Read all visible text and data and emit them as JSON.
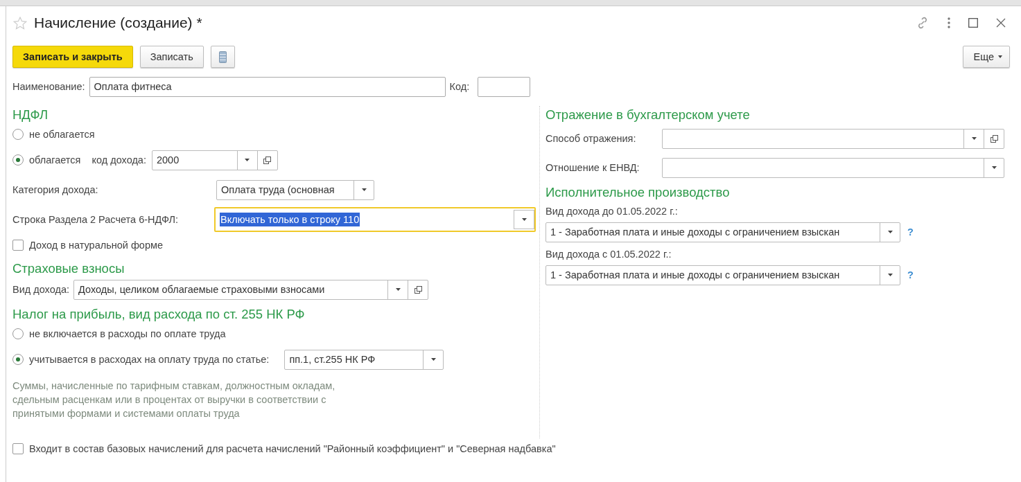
{
  "window": {
    "title": "Начисление (создание) *"
  },
  "toolbar": {
    "primary": "Записать и закрыть",
    "secondary": "Записать",
    "more": "Еще"
  },
  "header_fields": [
    {
      "label": "Наименование:",
      "value": "Оплата фитнеса",
      "kind": "text",
      "focused": false
    },
    {
      "label": "Код:",
      "kind": "text",
      "focused": false
    }
  ],
  "ndfl": {
    "title": "НДФЛ",
    "options": [
      {
        "label": "не облагается",
        "selected": false
      },
      {
        "label": "облагается",
        "selected": true,
        "field": {
          "label": "код дохода:",
          "value": "2000",
          "kind": "select-open",
          "focused": false
        }
      }
    ],
    "fields": [
      {
        "label": "Категория дохода:",
        "value": "Оплата труда (основная",
        "kind": "select",
        "focused": false
      },
      {
        "label": "Строка Раздела 2 Расчета 6-НДФЛ:",
        "value": "Включать только в строку 110",
        "kind": "select",
        "focused": true
      }
    ],
    "checkbox": {
      "label": "Доход в натуральной форме",
      "checked": false
    }
  },
  "insurance": {
    "title": "Страховые взносы",
    "field": {
      "label": "Вид дохода:",
      "value": "Доходы, целиком облагаемые страховыми взносами",
      "kind": "select-open",
      "focused": false
    }
  },
  "profit_tax": {
    "title": "Налог на прибыль, вид расхода по ст. 255 НК РФ",
    "options": [
      {
        "label": "не включается в расходы по оплате труда",
        "selected": false
      },
      {
        "label": "учитывается в расходах на оплату труда по статье:",
        "selected": true,
        "field": {
          "value": "пп.1, ст.255 НК РФ",
          "kind": "select",
          "focused": false
        }
      }
    ],
    "note": "Суммы, начисленные по тарифным ставкам, должностным окладам, сдельным расценкам или в процентах от выручки в соответствии с принятыми формами и системами оплаты труда"
  },
  "accounting": {
    "title": "Отражение в бухгалтерском учете",
    "fields": [
      {
        "label": "Способ отражения:",
        "kind": "select-open",
        "focused": false
      },
      {
        "label": "Отношение к ЕНВД:",
        "kind": "select",
        "focused": false
      }
    ]
  },
  "enforcement": {
    "title": "Исполнительное производство",
    "fields": [
      {
        "label": "Вид дохода до 01.05.2022 г.:",
        "value": "1 - Заработная плата и иные доходы с ограничением взыскан",
        "kind": "select",
        "focused": false,
        "help": "?"
      },
      {
        "label": "Вид дохода с 01.05.2022 г.:",
        "value": "1 - Заработная плата и иные доходы с ограничением взыскан",
        "kind": "select",
        "focused": false,
        "help": "?"
      }
    ]
  },
  "bottom_checkbox": {
    "label": "Входит в состав базовых начислений для расчета начислений \"Районный коэффициент\" и \"Северная надбавка\"",
    "checked": false
  }
}
